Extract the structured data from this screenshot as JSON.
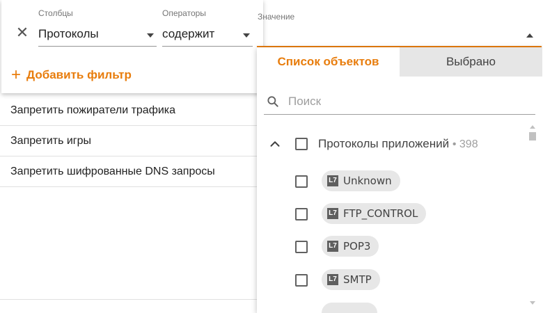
{
  "background_list": {
    "rows": [
      "Запретить пожиратели трафика",
      "Запретить игры",
      "Запретить шифрованные DNS запросы"
    ]
  },
  "filter": {
    "columns": {
      "label": "Столбцы",
      "value": "Протоколы"
    },
    "operators": {
      "label": "Операторы",
      "value": "содержит"
    },
    "value": {
      "label": "Значение",
      "value": ""
    },
    "add_filter_label": "Добавить фильтр"
  },
  "dropdown": {
    "tabs": {
      "active": "Список объектов",
      "inactive": "Выбрано"
    },
    "search_placeholder": "Поиск",
    "group": {
      "label": "Протоколы приложений",
      "count": "• 398"
    },
    "badge": "L7",
    "items": [
      {
        "label": "Unknown"
      },
      {
        "label": "FTP_CONTROL"
      },
      {
        "label": "POP3"
      },
      {
        "label": "SMTP"
      }
    ]
  },
  "colors": {
    "accent": "#e87d0d",
    "tab_inactive_bg": "#e6e6e6",
    "chip_bg": "#e7e7e7"
  },
  "icons": [
    "close-icon",
    "chevron-down-icon",
    "plus-icon",
    "search-icon",
    "chevron-up-icon",
    "checkbox-icon",
    "l7-badge-icon"
  ]
}
